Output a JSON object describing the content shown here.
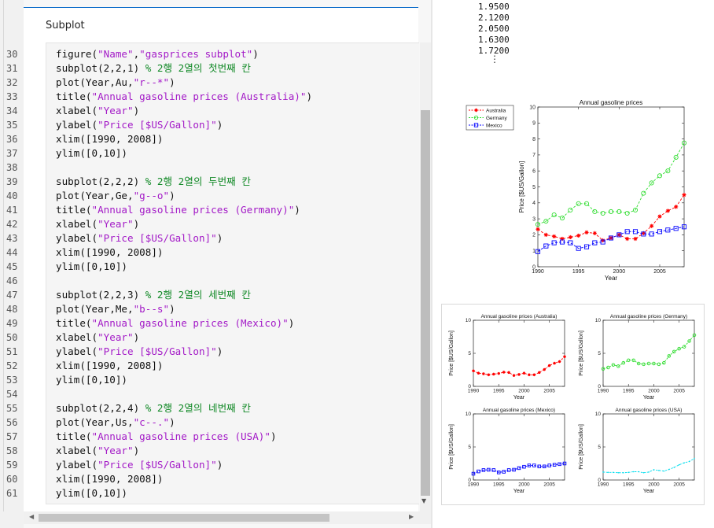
{
  "editor": {
    "section_title": "Subplot",
    "lines": [
      {
        "n": "30",
        "parts": [
          [
            "figure(",
            ""
          ],
          [
            "\"Name\"",
            "str"
          ],
          [
            ",",
            ""
          ],
          [
            "\"gasprices subplot\"",
            "str"
          ],
          [
            ")",
            ""
          ]
        ]
      },
      {
        "n": "31",
        "parts": [
          [
            "subplot(2,2,1) ",
            ""
          ],
          [
            "% 2행 2열의 첫번째 칸",
            "cmt"
          ]
        ]
      },
      {
        "n": "32",
        "parts": [
          [
            "plot(Year,Au,",
            ""
          ],
          [
            "\"r--*\"",
            "str"
          ],
          [
            ")",
            ""
          ]
        ]
      },
      {
        "n": "33",
        "parts": [
          [
            "title(",
            ""
          ],
          [
            "\"Annual gasoline prices (Australia)\"",
            "str"
          ],
          [
            ")",
            ""
          ]
        ]
      },
      {
        "n": "34",
        "parts": [
          [
            "xlabel(",
            ""
          ],
          [
            "\"Year\"",
            "str"
          ],
          [
            ")",
            ""
          ]
        ]
      },
      {
        "n": "35",
        "parts": [
          [
            "ylabel(",
            ""
          ],
          [
            "\"Price [$US/Gallon]\"",
            "str"
          ],
          [
            ")",
            ""
          ]
        ]
      },
      {
        "n": "36",
        "parts": [
          [
            "xlim([1990, 2008])",
            ""
          ]
        ]
      },
      {
        "n": "37",
        "parts": [
          [
            "ylim([0,10])",
            ""
          ]
        ]
      },
      {
        "n": "38",
        "parts": []
      },
      {
        "n": "39",
        "parts": [
          [
            "subplot(2,2,2) ",
            ""
          ],
          [
            "% 2행 2열의 두번째 칸",
            "cmt"
          ]
        ]
      },
      {
        "n": "40",
        "parts": [
          [
            "plot(Year,Ge,",
            ""
          ],
          [
            "\"g--o\"",
            "str"
          ],
          [
            ")",
            ""
          ]
        ]
      },
      {
        "n": "41",
        "parts": [
          [
            "title(",
            ""
          ],
          [
            "\"Annual gasoline prices (Germany)\"",
            "str"
          ],
          [
            ")",
            ""
          ]
        ]
      },
      {
        "n": "42",
        "parts": [
          [
            "xlabel(",
            ""
          ],
          [
            "\"Year\"",
            "str"
          ],
          [
            ")",
            ""
          ]
        ]
      },
      {
        "n": "43",
        "parts": [
          [
            "ylabel(",
            ""
          ],
          [
            "\"Price [$US/Gallon]\"",
            "str"
          ],
          [
            ")",
            ""
          ]
        ]
      },
      {
        "n": "44",
        "parts": [
          [
            "xlim([1990, 2008])",
            ""
          ]
        ]
      },
      {
        "n": "45",
        "parts": [
          [
            "ylim([0,10])",
            ""
          ]
        ]
      },
      {
        "n": "46",
        "parts": []
      },
      {
        "n": "47",
        "parts": [
          [
            "subplot(2,2,3) ",
            ""
          ],
          [
            "% 2행 2열의 세번째 칸",
            "cmt"
          ]
        ]
      },
      {
        "n": "48",
        "parts": [
          [
            "plot(Year,Me,",
            ""
          ],
          [
            "\"b--s\"",
            "str"
          ],
          [
            ")",
            ""
          ]
        ]
      },
      {
        "n": "49",
        "parts": [
          [
            "title(",
            ""
          ],
          [
            "\"Annual gasoline prices (Mexico)\"",
            "str"
          ],
          [
            ")",
            ""
          ]
        ]
      },
      {
        "n": "50",
        "parts": [
          [
            "xlabel(",
            ""
          ],
          [
            "\"Year\"",
            "str"
          ],
          [
            ")",
            ""
          ]
        ]
      },
      {
        "n": "51",
        "parts": [
          [
            "ylabel(",
            ""
          ],
          [
            "\"Price [$US/Gallon]\"",
            "str"
          ],
          [
            ")",
            ""
          ]
        ]
      },
      {
        "n": "52",
        "parts": [
          [
            "xlim([1990, 2008])",
            ""
          ]
        ]
      },
      {
        "n": "53",
        "parts": [
          [
            "ylim([0,10])",
            ""
          ]
        ]
      },
      {
        "n": "54",
        "parts": []
      },
      {
        "n": "55",
        "parts": [
          [
            "subplot(2,2,4) ",
            ""
          ],
          [
            "% 2행 2열의 네번째 칸",
            "cmt"
          ]
        ]
      },
      {
        "n": "56",
        "parts": [
          [
            "plot(Year,Us,",
            ""
          ],
          [
            "\"c--.\"",
            "str"
          ],
          [
            ")",
            ""
          ]
        ]
      },
      {
        "n": "57",
        "parts": [
          [
            "title(",
            ""
          ],
          [
            "\"Annual gasoline prices (USA)\"",
            "str"
          ],
          [
            ")",
            ""
          ]
        ]
      },
      {
        "n": "58",
        "parts": [
          [
            "xlabel(",
            ""
          ],
          [
            "\"Year\"",
            "str"
          ],
          [
            ")",
            ""
          ]
        ]
      },
      {
        "n": "59",
        "parts": [
          [
            "ylabel(",
            ""
          ],
          [
            "\"Price [$US/Gallon]\"",
            "str"
          ],
          [
            ")",
            ""
          ]
        ]
      },
      {
        "n": "60",
        "parts": [
          [
            "xlim([1990, 2008])",
            ""
          ]
        ]
      },
      {
        "n": "61",
        "parts": [
          [
            "ylim([0,10])",
            ""
          ]
        ]
      }
    ]
  },
  "output": {
    "values": [
      "1.9500",
      "2.1200",
      "2.0500",
      "1.6300",
      "1.7200"
    ],
    "ellipsis": "⋮"
  },
  "colors": {
    "red": "#ff0000",
    "green": "#33dd33",
    "blue": "#0000ff",
    "cyan": "#00ddee"
  },
  "chart_data": [
    {
      "type": "line",
      "title": "Annual gasoline prices",
      "xlabel": "Year",
      "ylabel": "Price [$US/Gallon]",
      "xlim": [
        1990,
        2008
      ],
      "ylim": [
        0,
        10
      ],
      "xticks": [
        "1990",
        "1995",
        "2000",
        "2005"
      ],
      "yticks": [
        "0",
        "1",
        "2",
        "3",
        "4",
        "5",
        "6",
        "7",
        "8",
        "9",
        "10"
      ],
      "legend_position": "top-left",
      "x": [
        1990,
        1991,
        1992,
        1993,
        1994,
        1995,
        1996,
        1997,
        1998,
        1999,
        2000,
        2001,
        2002,
        2003,
        2004,
        2005,
        2006,
        2007,
        2008
      ],
      "series": [
        {
          "name": "Australia",
          "color": "#ff0000",
          "marker": "*",
          "values": [
            2.35,
            2.0,
            1.9,
            1.75,
            1.85,
            1.95,
            2.15,
            2.1,
            1.65,
            1.8,
            2.0,
            1.75,
            1.75,
            2.1,
            2.55,
            3.15,
            3.5,
            3.75,
            4.5
          ]
        },
        {
          "name": "Germany",
          "color": "#33dd33",
          "marker": "o",
          "values": [
            2.65,
            2.85,
            3.25,
            3.05,
            3.55,
            3.95,
            3.95,
            3.45,
            3.35,
            3.45,
            3.45,
            3.35,
            3.55,
            4.6,
            5.25,
            5.7,
            6.0,
            6.85,
            7.75
          ]
        },
        {
          "name": "Mexico",
          "color": "#0000ff",
          "marker": "s",
          "values": [
            0.95,
            1.3,
            1.5,
            1.55,
            1.5,
            1.15,
            1.25,
            1.5,
            1.55,
            1.8,
            2.0,
            2.2,
            2.2,
            2.05,
            2.05,
            2.2,
            2.3,
            2.4,
            2.5
          ]
        }
      ]
    },
    {
      "type": "line",
      "title": "Annual gasoline prices (Australia)",
      "xlabel": "Year",
      "ylabel": "Price [$US/Gallon]",
      "xlim": [
        1990,
        2008
      ],
      "ylim": [
        0,
        10
      ],
      "xticks": [
        "1990",
        "1995",
        "2000",
        "2005"
      ],
      "yticks": [
        "0",
        "5",
        "10"
      ],
      "series": [
        {
          "color": "#ff0000",
          "marker": "*",
          "values": [
            2.35,
            2.0,
            1.9,
            1.75,
            1.85,
            1.95,
            2.15,
            2.1,
            1.65,
            1.8,
            2.0,
            1.75,
            1.75,
            2.1,
            2.55,
            3.15,
            3.5,
            3.75,
            4.5
          ]
        }
      ]
    },
    {
      "type": "line",
      "title": "Annual gasoline prices (Germany)",
      "xlabel": "Year",
      "ylabel": "Price [$US/Gallon]",
      "xlim": [
        1990,
        2008
      ],
      "ylim": [
        0,
        10
      ],
      "xticks": [
        "1990",
        "1995",
        "2000",
        "2005"
      ],
      "yticks": [
        "0",
        "5",
        "10"
      ],
      "series": [
        {
          "color": "#33dd33",
          "marker": "o",
          "values": [
            2.65,
            2.85,
            3.25,
            3.05,
            3.55,
            3.95,
            3.95,
            3.45,
            3.35,
            3.45,
            3.45,
            3.35,
            3.55,
            4.6,
            5.25,
            5.7,
            6.0,
            6.85,
            7.75
          ]
        }
      ]
    },
    {
      "type": "line",
      "title": "Annual gasoline prices (Mexico)",
      "xlabel": "Year",
      "ylabel": "Price [$US/Gallon]",
      "xlim": [
        1990,
        2008
      ],
      "ylim": [
        0,
        10
      ],
      "xticks": [
        "1990",
        "1995",
        "2000",
        "2005"
      ],
      "yticks": [
        "0",
        "5",
        "10"
      ],
      "series": [
        {
          "color": "#0000ff",
          "marker": "s",
          "values": [
            0.95,
            1.3,
            1.5,
            1.55,
            1.5,
            1.15,
            1.25,
            1.5,
            1.55,
            1.8,
            2.0,
            2.2,
            2.2,
            2.05,
            2.05,
            2.2,
            2.3,
            2.4,
            2.5
          ]
        }
      ]
    },
    {
      "type": "line",
      "title": "Annual gasoline prices (USA)",
      "xlabel": "Year",
      "ylabel": "Price [$US/Gallon]",
      "xlim": [
        1990,
        2008
      ],
      "ylim": [
        0,
        10
      ],
      "xticks": [
        "1990",
        "1995",
        "2000",
        "2005"
      ],
      "yticks": [
        "0",
        "5",
        "10"
      ],
      "series": [
        {
          "color": "#00ddee",
          "marker": ".",
          "values": [
            1.2,
            1.15,
            1.15,
            1.1,
            1.1,
            1.15,
            1.25,
            1.25,
            1.1,
            1.2,
            1.55,
            1.45,
            1.35,
            1.6,
            1.9,
            2.3,
            2.6,
            2.8,
            3.25
          ]
        }
      ]
    }
  ]
}
